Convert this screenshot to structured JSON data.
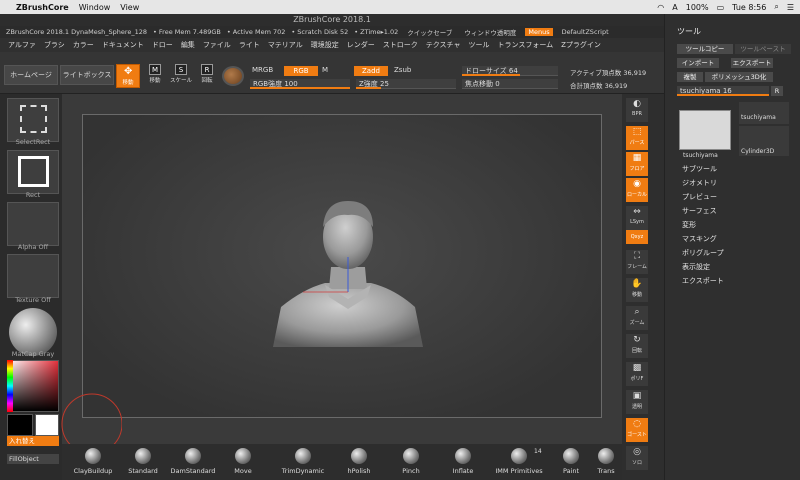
{
  "macbar": {
    "app": "ZBrushCore",
    "menus": [
      "Window",
      "View"
    ],
    "input_badge": "A",
    "battery": "100%",
    "clock": "Tue 8:56"
  },
  "window_title": "ZBrushCore 2018.1",
  "info": {
    "file": "ZBrushCore 2018.1 DynaMesh_Sphere_128",
    "free_mem": "• Free Mem 7.489GB",
    "active_mem": "• Active Mem 702",
    "scratch": "• Scratch Disk 52",
    "ztime": "• ZTime▸1.02",
    "quicksave": "クイックセーブ",
    "transparency": "ウィンドウ透明度",
    "menus_btn": "Menus",
    "script": "DefaultZScript"
  },
  "menu": [
    "アルファ",
    "ブラシ",
    "カラー",
    "ドキュメント",
    "ドロー",
    "編集",
    "ファイル",
    "ライト",
    "マテリアル",
    "環境設定",
    "レンダー",
    "ストローク",
    "テクスチャ",
    "ツール",
    "トランスフォーム",
    "Zプラグイン"
  ],
  "shelf": {
    "home": "ホームページ",
    "lightbox": "ライトボックス",
    "move": "移動",
    "icons": [
      {
        "label": "移動",
        "glyph": "M"
      },
      {
        "label": "スケール",
        "glyph": "S"
      },
      {
        "label": "回転",
        "glyph": "R"
      }
    ],
    "mrgb": "MRGB",
    "rgb": "RGB",
    "m": "M",
    "zadd": "Zadd",
    "zsub": "Zsub",
    "rgb_intensity": "RGB強度 100",
    "z_intensity": "Z強度 25",
    "draw_size": "ドローサイズ 64",
    "focal_shift": "焦点移動 0",
    "active_points": "アクティブ頂点数 36,919",
    "total_points": "合計頂点数 36,919"
  },
  "left": {
    "select_rect": "SelectRect",
    "rect": "Rect",
    "alpha": "Alpha Off",
    "texture": "Texture Off",
    "matcap": "MatCap Gray",
    "swap": "入れ替え",
    "fill": "FillObject"
  },
  "rightcol": [
    {
      "label": "BPR",
      "glyph": "◐",
      "on": false
    },
    {
      "label": "パース",
      "glyph": "⬚",
      "on": true
    },
    {
      "label": "フロア",
      "glyph": "▦",
      "on": true
    },
    {
      "label": "ローカル",
      "glyph": "◉",
      "on": true
    },
    {
      "label": "LSym",
      "glyph": "⇔",
      "on": false
    },
    {
      "label": "Qxyz",
      "glyph": "✣",
      "on": true
    },
    {
      "label": "フレーム",
      "glyph": "⛶",
      "on": false
    },
    {
      "label": "移動",
      "glyph": "✋",
      "on": false
    },
    {
      "label": "ズーム",
      "glyph": "⌕",
      "on": false
    },
    {
      "label": "回転",
      "glyph": "↻",
      "on": false
    },
    {
      "label": "ポリF",
      "glyph": "▩",
      "on": false
    },
    {
      "label": "透明",
      "glyph": "▣",
      "on": false
    },
    {
      "label": "ゴースト",
      "glyph": "◌",
      "on": true
    },
    {
      "label": "ソロ",
      "glyph": "◎",
      "on": false
    }
  ],
  "tool": {
    "title": "ツール",
    "copy": "ツールコピー",
    "paste": "ツールペースト",
    "import": "インポート",
    "export": "エクスポート",
    "clone": "複製",
    "poly3d": "ポリメッシュ3D化",
    "current": "tsuchiyama  16",
    "r": "R",
    "thumb_main": "tsuchiyama",
    "thumb_sub1": "tsuchiyama",
    "thumb_sub2": "Cylinder3D",
    "sections": [
      "サブツール",
      "ジオメトリ",
      "プレビュー",
      "サーフェス",
      "変形",
      "マスキング",
      "ポリグループ",
      "表示設定",
      "エクスポート"
    ]
  },
  "brushes": [
    {
      "name": "ClayBuildup"
    },
    {
      "name": "Standard"
    },
    {
      "name": "DamStandard"
    },
    {
      "name": "Move"
    },
    {
      "name": "TrimDynamic"
    },
    {
      "name": "hPolish"
    },
    {
      "name": "Pinch"
    },
    {
      "name": "Inflate"
    },
    {
      "name": "IMM Primitives"
    },
    {
      "name": "Paint"
    },
    {
      "name": "Trans"
    }
  ],
  "imm_count": "14",
  "colors": {
    "accent": "#f07c12",
    "bg": "#2a2a2a"
  }
}
